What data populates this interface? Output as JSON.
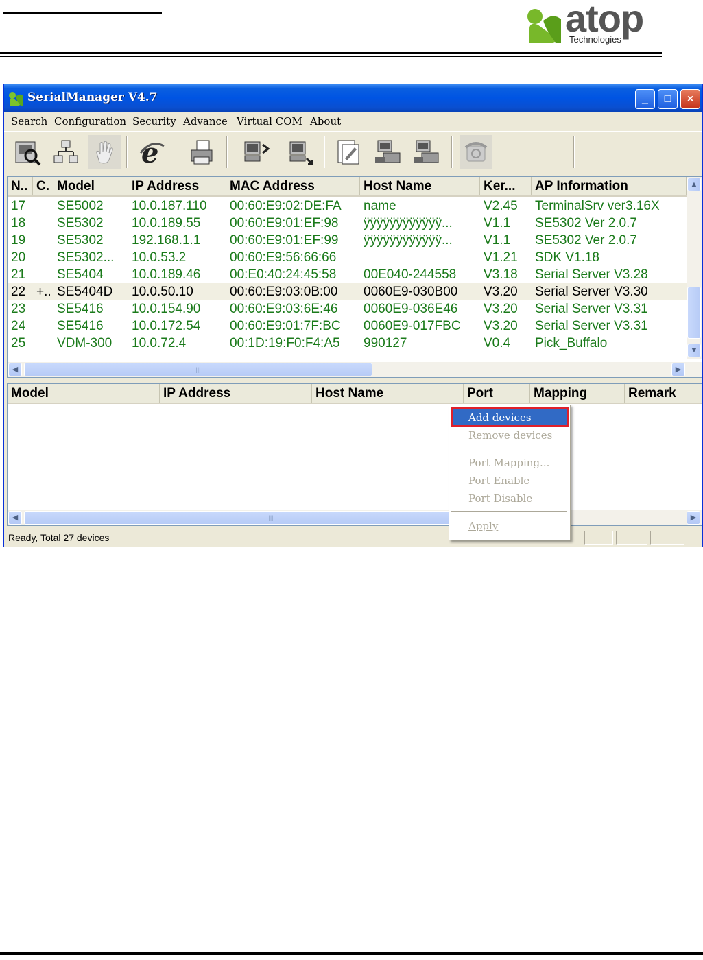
{
  "logo": {
    "word": "atop",
    "sub": "Technologies"
  },
  "window": {
    "title": "SerialManager V4.7",
    "controls": {
      "minimize": "_",
      "maximize": "□",
      "close": "×"
    }
  },
  "menu": [
    "Search",
    "Configuration",
    "Security",
    "Advance",
    "Virtual COM",
    "About"
  ],
  "toolbar": [
    "search-device-icon",
    "network-config-icon",
    "hand-icon",
    "internet-explorer-icon",
    "printer-icon",
    "computer-back-icon",
    "computer-forward-icon",
    "document-edit-icon",
    "serial-device-icon",
    "serial-device-2-icon",
    "phone-icon"
  ],
  "device_list": {
    "columns": [
      "N..",
      "C.",
      "Model",
      "IP Address",
      "MAC Address",
      "Host Name",
      "Ker...",
      "AP Information"
    ],
    "rows": [
      {
        "n": "17",
        "c": "",
        "model": "SE5002",
        "ip": "10.0.187.110",
        "mac": "00:60:E9:02:DE:FA",
        "host": "name",
        "kernel": "V2.45",
        "ap": "TerminalSrv ver3.16X"
      },
      {
        "n": "18",
        "c": "",
        "model": "SE5302",
        "ip": "10.0.189.55",
        "mac": "00:60:E9:01:EF:98",
        "host": "ÿÿÿÿÿÿÿÿÿÿÿÿ...",
        "kernel": "V1.1",
        "ap": "SE5302 Ver 2.0.7"
      },
      {
        "n": "19",
        "c": "",
        "model": "SE5302",
        "ip": "192.168.1.1",
        "mac": "00:60:E9:01:EF:99",
        "host": "ÿÿÿÿÿÿÿÿÿÿÿÿ...",
        "kernel": "V1.1",
        "ap": "SE5302 Ver 2.0.7"
      },
      {
        "n": "20",
        "c": "",
        "model": "SE5302...",
        "ip": "10.0.53.2",
        "mac": "00:60:E9:56:66:66",
        "host": "",
        "kernel": "V1.21",
        "ap": "SDK V1.18"
      },
      {
        "n": "21",
        "c": "",
        "model": "SE5404",
        "ip": "10.0.189.46",
        "mac": "00:E0:40:24:45:58",
        "host": "00E040-244558",
        "kernel": "V3.18",
        "ap": "Serial Server V3.28"
      },
      {
        "n": "22",
        "c": "+..",
        "model": "SE5404D",
        "ip": "10.0.50.10",
        "mac": "00:60:E9:03:0B:00",
        "host": "0060E9-030B00",
        "kernel": "V3.20",
        "ap": "Serial Server V3.30"
      },
      {
        "n": "23",
        "c": "",
        "model": "SE5416",
        "ip": "10.0.154.90",
        "mac": "00:60:E9:03:6E:46",
        "host": "0060E9-036E46",
        "kernel": "V3.20",
        "ap": "Serial Server V3.31"
      },
      {
        "n": "24",
        "c": "",
        "model": "SE5416",
        "ip": "10.0.172.54",
        "mac": "00:60:E9:01:7F:BC",
        "host": "0060E9-017FBC",
        "kernel": "V3.20",
        "ap": "Serial Server V3.31"
      },
      {
        "n": "25",
        "c": "",
        "model": "VDM-300",
        "ip": "10.0.72.4",
        "mac": "00:1D:19:F0:F4:A5",
        "host": "990127",
        "kernel": "V0.4",
        "ap": "Pick_Buffalo"
      }
    ],
    "selected_row": "22"
  },
  "mapping_list": {
    "columns": [
      "Model",
      "IP Address",
      "Host Name",
      "Port",
      "Mapping",
      "Remark"
    ]
  },
  "context_menu": {
    "items": [
      "Add devices",
      "Remove devices",
      "Port Mapping...",
      "Port Enable",
      "Port Disable",
      "Apply"
    ],
    "active": "Add devices"
  },
  "status": "Ready, Total 27 devices",
  "colors": {
    "row_text": "#1a7a1a",
    "highlight": "#e0202a",
    "menu_active": "#316ac5"
  }
}
